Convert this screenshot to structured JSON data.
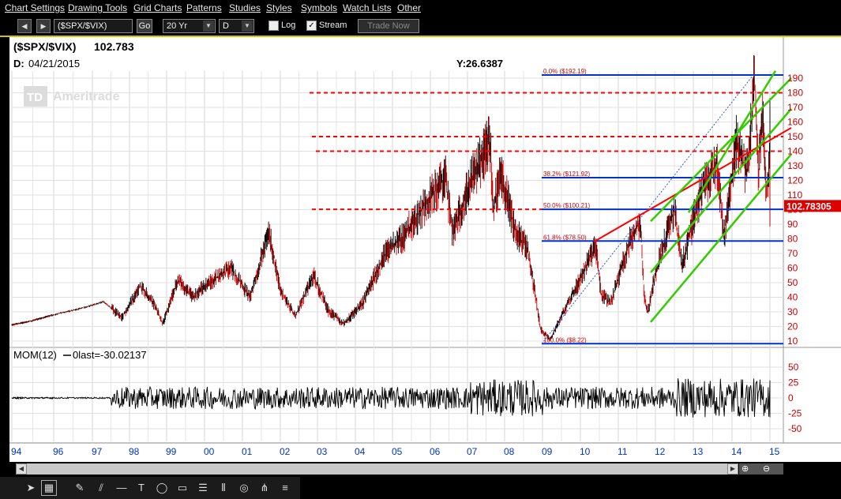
{
  "menu": [
    "Chart Settings",
    "Drawing Tools",
    "Grid Charts",
    "Patterns",
    "Studies",
    "Styles",
    "Symbols",
    "Watch Lists",
    "Other"
  ],
  "toolbar": {
    "back_label": "◀",
    "forward_label": "▶",
    "symbol_value": "($SPX/$VIX)",
    "go_label": "Go",
    "range_value": "20 Yr",
    "period_value": "D",
    "log_label": "Log",
    "log_checked": false,
    "stream_label": "Stream",
    "stream_checked": true,
    "trade_now_label": "Trade Now"
  },
  "chart": {
    "title": "($SPX/$VIX)",
    "last_value": "102.783",
    "date_label": "D:",
    "date_value": "04/21/2015",
    "y_readout": "Y:26.6387",
    "watermark": "Ameritrade",
    "last_badge": "102.78305",
    "indicator_label": "MOM(12)",
    "indicator_info": "0last=-30.02137",
    "fib_labels": [
      "0.0%   ($192.19)",
      "38.2%   ($121.92)",
      "50.0%   ($100.21)",
      "61.8%   ($78.50)",
      "100.0%   ($8.22)"
    ],
    "colors": {
      "price_up": "#000000",
      "price_down": "#cc0000",
      "fib_lines": "#0033cc",
      "resistance": "#ff0000",
      "channel": "#33cc00",
      "axis_text_right": "#cc0000",
      "axis_text_bottom": "#0033cc",
      "badge_bg": "#dd0000"
    }
  },
  "chart_data": {
    "type": "line",
    "title": "($SPX/$VIX)",
    "x_ticks": [
      "94",
      "96",
      "97",
      "98",
      "99",
      "00",
      "01",
      "02",
      "03",
      "04",
      "05",
      "06",
      "07",
      "08",
      "09",
      "10",
      "11",
      "12",
      "13",
      "14",
      "15"
    ],
    "y_ticks": [
      10,
      20,
      30,
      40,
      50,
      60,
      70,
      80,
      90,
      100,
      110,
      120,
      130,
      140,
      150,
      160,
      170,
      180,
      190
    ],
    "ylim": [
      5,
      195
    ],
    "series": [
      {
        "values": [
          [
            1994.0,
            21
          ],
          [
            1995.0,
            24
          ],
          [
            1996.0,
            28
          ],
          [
            1996.8,
            33
          ],
          [
            1997.3,
            37
          ],
          [
            1997.8,
            26
          ],
          [
            1998.3,
            48
          ],
          [
            1998.7,
            34
          ],
          [
            1998.9,
            22
          ],
          [
            1999.3,
            52
          ],
          [
            1999.7,
            40
          ],
          [
            2000.0,
            48
          ],
          [
            2000.7,
            60
          ],
          [
            2001.2,
            40
          ],
          [
            2001.7,
            85
          ],
          [
            2002.0,
            45
          ],
          [
            2002.4,
            27
          ],
          [
            2002.9,
            55
          ],
          [
            2003.3,
            30
          ],
          [
            2003.7,
            22
          ],
          [
            2004.2,
            36
          ],
          [
            2004.8,
            70
          ],
          [
            2005.3,
            82
          ],
          [
            2005.9,
            105
          ],
          [
            2006.4,
            122
          ],
          [
            2006.6,
            84
          ],
          [
            2007.0,
            114
          ],
          [
            2007.4,
            135
          ],
          [
            2007.6,
            150
          ],
          [
            2007.7,
            100
          ],
          [
            2007.9,
            125
          ],
          [
            2008.3,
            84
          ],
          [
            2008.6,
            74
          ],
          [
            2008.8,
            44
          ],
          [
            2008.95,
            18
          ],
          [
            2009.2,
            11
          ],
          [
            2009.6,
            32
          ],
          [
            2010.1,
            58
          ],
          [
            2010.4,
            76
          ],
          [
            2010.55,
            42
          ],
          [
            2010.8,
            36
          ],
          [
            2011.3,
            78
          ],
          [
            2011.6,
            92
          ],
          [
            2011.7,
            40
          ],
          [
            2011.8,
            30
          ],
          [
            2012.0,
            57
          ],
          [
            2012.5,
            100
          ],
          [
            2012.7,
            62
          ],
          [
            2013.2,
            112
          ],
          [
            2013.6,
            132
          ],
          [
            2013.8,
            82
          ],
          [
            2014.1,
            146
          ],
          [
            2014.4,
            124
          ],
          [
            2014.6,
            190
          ],
          [
            2014.7,
            122
          ],
          [
            2014.8,
            172
          ],
          [
            2014.9,
            110
          ],
          [
            2015.1,
            160
          ],
          [
            2015.3,
            102.8
          ]
        ]
      }
    ],
    "horizontal_lines": [
      192.19,
      180,
      150,
      140,
      121.92,
      100.21,
      78.5,
      8.22
    ],
    "momentum": {
      "label": "MOM(12)",
      "last": -30.02137,
      "y_ticks": [
        50,
        25,
        0,
        -25,
        -50
      ],
      "ylim": [
        -62,
        62
      ]
    }
  },
  "bottom": {
    "scroll_left": "◀",
    "scroll_right": "▶"
  },
  "drawing_tools": [
    "pointer-tool",
    "crosshair-tool",
    "pencil-tool",
    "trendline-tool",
    "parallel-tool",
    "horizontal-tool",
    "text-tool",
    "ellipse-tool",
    "rectangle-tool",
    "fib-retracement-tool",
    "fib-timezones-tool",
    "gann-tool",
    "pitchfork-tool",
    "regression-tool"
  ]
}
